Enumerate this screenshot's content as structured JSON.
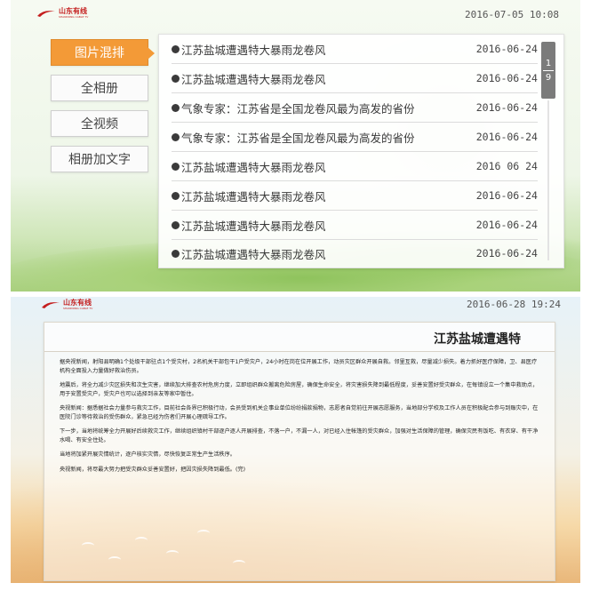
{
  "top_screen": {
    "logo_text": "山东有线",
    "logo_sub": "SHANDONG CABLE TV",
    "clock": "2016-07-05 10:08",
    "menu": [
      {
        "label": "图片混排",
        "active": true
      },
      {
        "label": "全相册",
        "active": false
      },
      {
        "label": "全视频",
        "active": false
      },
      {
        "label": "相册加文字",
        "active": false
      }
    ],
    "news": [
      {
        "title": "江苏盐城遭遇特大暴雨龙卷风",
        "date": "2016-06-24"
      },
      {
        "title": "江苏盐城遭遇特大暴雨龙卷风",
        "date": "2016-06-24"
      },
      {
        "title": "气象专家：江苏省是全国龙卷风最为高发的省份",
        "date": "2016-06-24"
      },
      {
        "title": "气象专家：江苏省是全国龙卷风最为高发的省份",
        "date": "2016-06-24"
      },
      {
        "title": "江苏盐城遭遇特大暴雨龙卷风",
        "date": "2016 06 24"
      },
      {
        "title": "江苏盐城遭遇特大暴雨龙卷风",
        "date": "2016-06-24"
      },
      {
        "title": "江苏盐城遭遇特大暴雨龙卷风",
        "date": "2016-06-24"
      },
      {
        "title": "江苏盐城遭遇特大暴雨龙卷风",
        "date": "2016-06-24"
      }
    ],
    "pager": {
      "current": "1",
      "total": "9"
    }
  },
  "bottom_screen": {
    "logo_text": "山东有线",
    "logo_sub": "SHANDONG CABLE TV",
    "clock": "2016-06-28 19:24",
    "article_title": "江苏盐城遭遇特",
    "paragraphs": [
      "据央视新闻，射阳县明确1个处级干部驻点1个受灾村，2名机关干部包干1户受灾户，24小时在岗在位开展工作，动员灾区群众开展自救。邻里互救，尽量减少损失。着力抓好医疗保障，卫、县医疗机构全面投入力量做好救治伤员。",
      "地震后，将全力减少灾区损失和次生灾害，继续加大排查农村危房力度，立即组织群众搬离危险房屋，确保生命安全，将灾害损失降到最低程度，妥善安置好受灾群众，在每镇设立一个集中救助点，用于安置受灾户，受灾户也可以选择到亲友等家中暂住。",
      "央视新闻：据悉据社会力量参与救灾工作，目前社会各界已积极行动，会员受到机关企事业单位纷纷捐款捐物，志愿者自觉前往开展志愿服务，当地部分学校及工作人员在积极配合参与到赈灾中，在医院门诊等待救治的受伤群众，紧急已经为伤者们开展心理疏导工作。",
      "下一步，当地将统筹全力开展好后续救灾工作，继续组织镇村干部逐户逐人开展排查，不落一户，不漏一人，对已经入住帐篷的受灾群众，加强对生活保障的管理，确保灾民有饭吃、有衣穿、有干净水喝、有安全住处。",
      "当地将加紧开展灾情统计，逐户核实灾情，尽快恢复正常生产生活秩序。",
      "央视新闻，将尽最大努力把受灾群众妥善安置好，把因灾损失降到最低。(完)"
    ]
  }
}
